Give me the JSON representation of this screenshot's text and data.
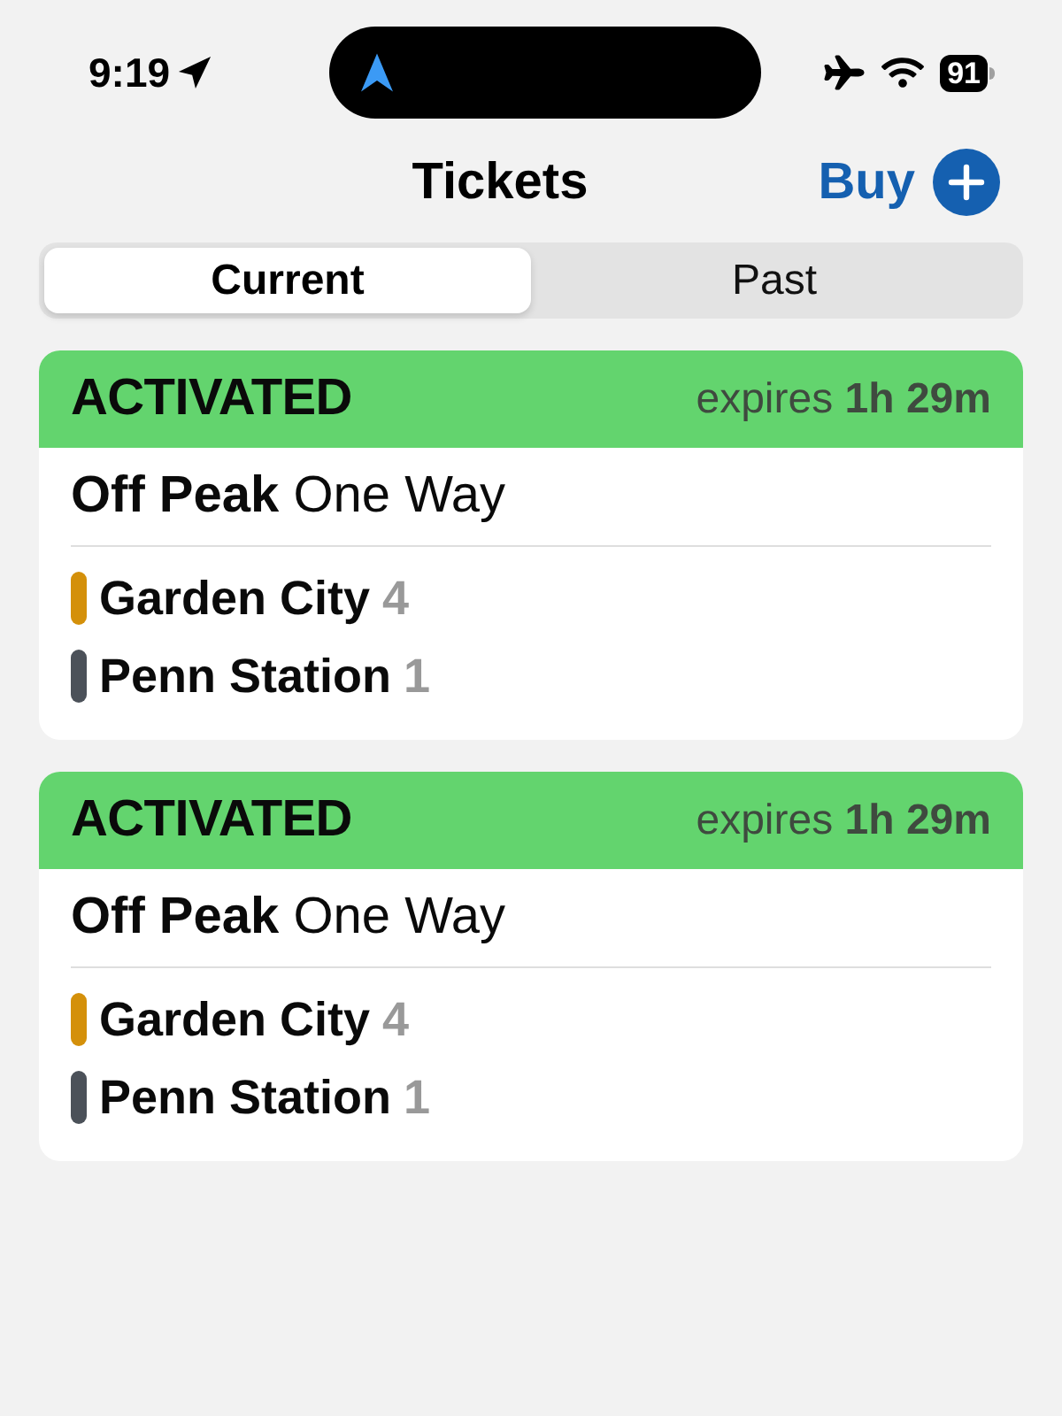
{
  "status_bar": {
    "time": "9:19",
    "battery": "91"
  },
  "nav": {
    "title": "Tickets",
    "buy_button": "Buy"
  },
  "tabs": [
    {
      "label": "Current",
      "selected": true
    },
    {
      "label": "Past",
      "selected": false
    }
  ],
  "tickets": [
    {
      "status": "ACTIVATED",
      "expiry": "expires **1h 29m**",
      "ticket_type": "**Off Peak** One Way",
      "stops": [
        {
          "name": "Garden City",
          "zone": "4",
          "color": "#d4900a"
        },
        {
          "name": "Penn Station",
          "zone": "1",
          "color": "#4b5159"
        }
      ]
    },
    {
      "status": "ACTIVATED",
      "expiry": "expires **1h 29m**",
      "ticket_type": "**Off Peak** One Way",
      "stops": [
        {
          "name": "Garden City",
          "zone": "4",
          "color": "#d4900a"
        },
        {
          "name": "Penn Station",
          "zone": "1",
          "color": "#4b5159"
        }
      ]
    }
  ]
}
